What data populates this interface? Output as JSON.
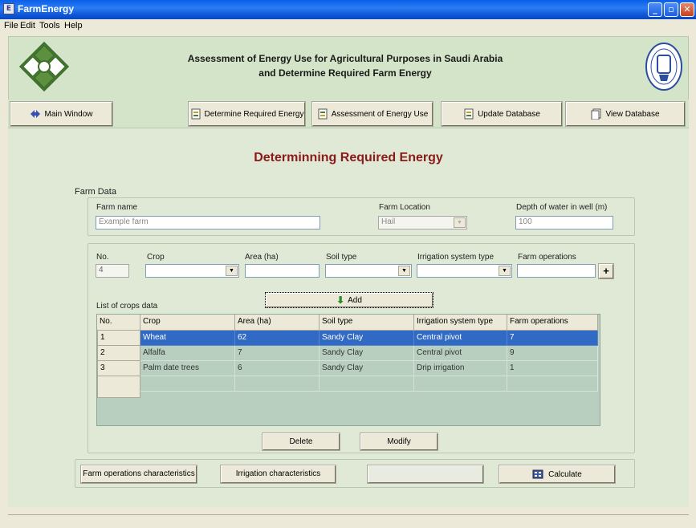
{
  "window": {
    "title": "FarmEnergy"
  },
  "menu": [
    "File",
    "Edit",
    "Tools",
    "Help"
  ],
  "header": {
    "title_line1": "Assessment of Energy Use for Agricultural Purposes in Saudi Arabia",
    "title_line2": "and Determine Required Farm Energy"
  },
  "toolbar": {
    "main_window": "Main Window",
    "determine_energy": "Determine Required Energy",
    "assessment": "Assessment of Energy Use",
    "update_db": "Update Database",
    "view_db": "View Database"
  },
  "page": {
    "title": "Determinning Required Energy"
  },
  "farm_data": {
    "group_label": "Farm Data",
    "farm_name_label": "Farm name",
    "farm_name_value": "Example farm",
    "location_label": "Farm Location",
    "location_value": "Hail",
    "depth_label": "Depth of water in well (m)",
    "depth_value": "100"
  },
  "crop_entry": {
    "no_label": "No.",
    "no_value": "4",
    "crop_label": "Crop",
    "area_label": "Area (ha)",
    "soil_label": "Soil type",
    "irrigation_label": "Irrigation system type",
    "operations_label": "Farm operations",
    "plus": "+",
    "add_button": "Add"
  },
  "crops_list": {
    "label": "List of crops data",
    "columns": [
      "No.",
      "Crop",
      "Area (ha)",
      "Soil type",
      "Irrigation system type",
      "Farm operations"
    ],
    "rows": [
      [
        "1",
        "Wheat",
        "62",
        "Sandy Clay",
        "Central pivot",
        "7"
      ],
      [
        "2",
        "Alfalfa",
        "7",
        "Sandy Clay",
        "Central pivot",
        "9"
      ],
      [
        "3",
        "Palm date trees",
        "6",
        "Sandy Clay",
        "Drip irrigation",
        "1"
      ]
    ],
    "delete_button": "Delete",
    "modify_button": "Modify"
  },
  "bottom": {
    "farm_ops_button": "Farm operations characteristics",
    "irrigation_button": "Irrigation characteristics",
    "calculate_button": "Calculate"
  },
  "colors": {
    "page_title": "#8b1a1a",
    "selection": "#316ac5",
    "header_bg": "#d4e4c9"
  }
}
